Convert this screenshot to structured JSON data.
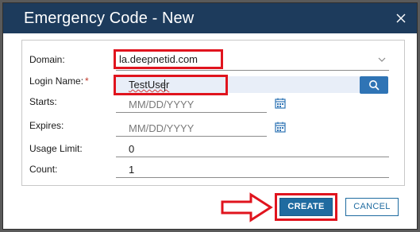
{
  "dialog": {
    "title": "Emergency Code - New",
    "close_icon": "close-icon"
  },
  "form": {
    "domain": {
      "label": "Domain:",
      "value": "la.deepnetid.com",
      "icon": "chevron-down-icon"
    },
    "login_name": {
      "label": "Login Name:",
      "required_marker": "*",
      "value": "TestUser",
      "search_icon": "search-icon"
    },
    "starts": {
      "label": "Starts:",
      "placeholder": "MM/DD/YYYY",
      "icon": "calendar-icon"
    },
    "expires": {
      "label": "Expires:",
      "placeholder": "MM/DD/YYYY",
      "icon": "calendar-icon"
    },
    "usage_limit": {
      "label": "Usage Limit:",
      "value": "0"
    },
    "count": {
      "label": "Count:",
      "value": "1"
    }
  },
  "buttons": {
    "create": "CREATE",
    "cancel": "CANCEL"
  },
  "annotations": {
    "highlight_color": "#e0141e",
    "arrow_icon": "right-arrow-icon"
  },
  "colors": {
    "titlebar": "#1d3b5c",
    "primary": "#1f6ba0",
    "search_button": "#2f74b5"
  }
}
